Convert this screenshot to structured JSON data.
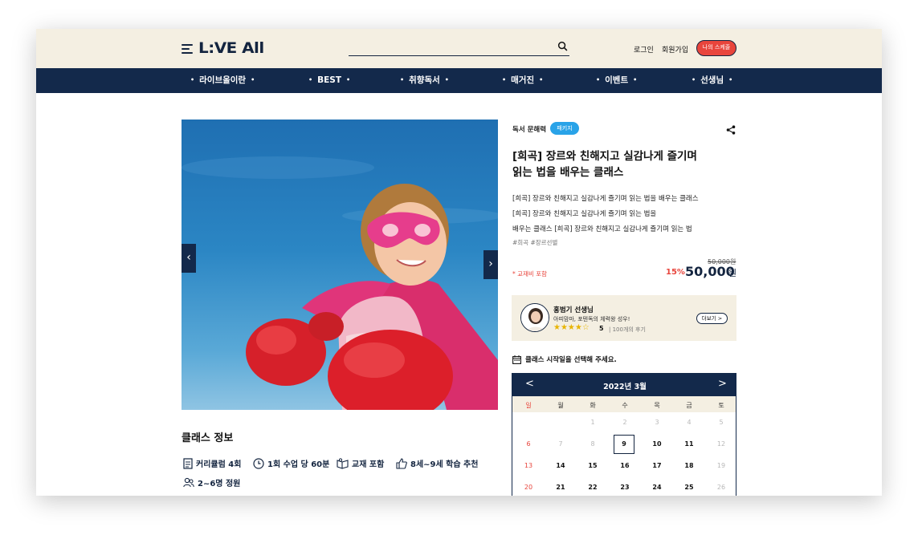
{
  "header": {
    "logo": "L:VE All",
    "search_placeholder": "",
    "login": "로그인",
    "signup": "회원가입",
    "my_study": "나의 스케줄"
  },
  "nav": [
    {
      "label": "라이브올이란"
    },
    {
      "label": "BEST"
    },
    {
      "label": "취향독서"
    },
    {
      "label": "매거진"
    },
    {
      "label": "이벤트"
    },
    {
      "label": "선생님"
    }
  ],
  "class_info": {
    "title": "클래스 정보",
    "items": [
      "커리큘럼 4회",
      "1회 수업 당 60분",
      "교재 포함",
      "8세~9세 학습 추천",
      "2~6명 정원"
    ]
  },
  "product": {
    "category": "독서 문해력",
    "badge": "패키지",
    "title_line1": "[희곡] 장르와 친해지고 실감나게 즐기며",
    "title_line2": "읽는 법을 배우는 클래스",
    "desc_line1": "[희곡] 장르와 친해지고 실감나게 즐기며 읽는 법을 배우는 클래스",
    "desc_line2": "[희곡] 장르와 친해지고 실감나게 즐기며 읽는 법을",
    "desc_line3": "배우는 클래스 [희곡] 장르와 친해지고 실감나게 즐기며 읽는 법",
    "tags": "#희곡   #장르선별",
    "note": "* 교재비 포함",
    "old_price": "50,000원",
    "discount": "15%",
    "price": "50,000",
    "currency": "원"
  },
  "teacher": {
    "name": "홍범기 선생님",
    "subtitle": "아띠맘마, 포텐독의 체력왕 성우!",
    "stars": "★★★★☆",
    "rating": "5",
    "reviews": "| 100개의 후기",
    "more": "더보기 >"
  },
  "calendar": {
    "hint": "클래스 시작일을 선택해 주세요.",
    "month": "2022년 3월",
    "prev": "<",
    "next": ">",
    "weekdays": [
      "일",
      "월",
      "화",
      "수",
      "목",
      "금",
      "토"
    ],
    "weeks": [
      [
        "",
        "",
        "1",
        "2",
        "3",
        "4",
        "5"
      ],
      [
        "6",
        "7",
        "8",
        "9",
        "10",
        "11",
        "12"
      ],
      [
        "13",
        "14",
        "15",
        "16",
        "17",
        "18",
        "19"
      ],
      [
        "20",
        "21",
        "22",
        "23",
        "24",
        "25",
        "26"
      ]
    ],
    "selected": "9",
    "colors": {
      "sunday": "#e8453c",
      "disabled": "#b8b8b8",
      "enabled": "#111111"
    }
  }
}
